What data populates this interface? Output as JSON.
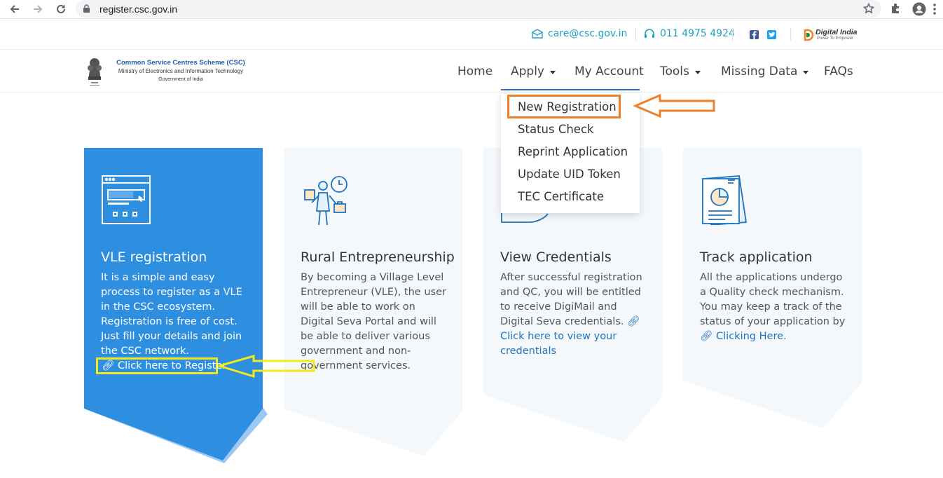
{
  "browser": {
    "url": "register.csc.gov.in"
  },
  "topbar": {
    "email": "care@csc.gov.in",
    "phone": "011 4975 4924",
    "partner_logo_title": "Digital India",
    "partner_logo_tagline": "Power To Empower"
  },
  "header": {
    "brand_line1": "Common Service Centres Scheme (CSC)",
    "brand_line2": "Ministry of Electronics and Information Technology",
    "brand_line3": "Government of India",
    "menu": {
      "home": "Home",
      "apply": "Apply",
      "my_account": "My Account",
      "tools": "Tools",
      "missing_data": "Missing Data",
      "faqs": "FAQs"
    }
  },
  "apply_dropdown": {
    "items": [
      "New Registration",
      "Status Check",
      "Reprint Application",
      "Update UID Token",
      "TEC Certificate"
    ]
  },
  "cards": [
    {
      "title": "VLE registration",
      "text": "It is a simple and easy process to register as a VLE in the CSC ecosystem. Registration is free of cost. Just fill your details and join the CSC network.",
      "link": "Click here to Register"
    },
    {
      "title": "Rural Entrepreneurship",
      "text": "By becoming a Village Level Entrepreneur (VLE), the user will be able to work on Digital Seva Portal and will be able to deliver various government and non-government services.",
      "link": ""
    },
    {
      "title": "View Credentials",
      "text": "After successful registration and QC, you will be entitled to receive DigiMail and Digital Seva credentials.",
      "link": "Click here to view your credentials"
    },
    {
      "title": "Track application",
      "text": "All the applications undergo a Quality check mechanism. You may keep a track of the status of your application by",
      "link": "Clicking Here."
    }
  ],
  "colors": {
    "brand_blue": "#2e8ee0",
    "link_blue": "#1e73be",
    "topbar_teal": "#1fa1c3",
    "annotation_orange": "#f07f2a",
    "annotation_yellow": "#f2ea1c",
    "card_grey": "#f5f8fb"
  }
}
